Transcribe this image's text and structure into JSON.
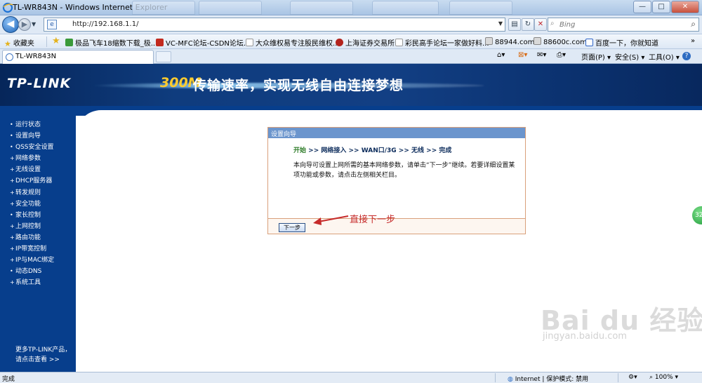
{
  "window": {
    "title": "TL-WR843N - Windows Internet Explorer",
    "min": "—",
    "max": "□",
    "close": "✕"
  },
  "address": {
    "url": "http://192.168.1.1/",
    "search_placeholder": "Bing"
  },
  "favorites": {
    "label": "收藏夹",
    "items": [
      "极品飞车18缩数下载_极...",
      "VC-MFC论坛-CSDN论坛...",
      "大众维权易专注股民维权...",
      "上海证券交易所",
      "彩民高手论坛一家做好料...",
      "88944.com-",
      "88600c.com-",
      "百度一下，你就知道"
    ]
  },
  "tabs": {
    "active": "TL-WR843N"
  },
  "commands": {
    "page": "页面(P)",
    "safety": "安全(S)",
    "tools": "工具(O)",
    "help": "?"
  },
  "banner": {
    "logo": "TP-LINK",
    "slogan_num": "300M",
    "slogan": "传输速率，实现无线自由连接梦想"
  },
  "sidebar": {
    "items": [
      "运行状态",
      "设置向导",
      "QSS安全设置",
      "网络参数",
      "无线设置",
      "DHCP服务器",
      "转发规则",
      "安全功能",
      "家长控制",
      "上网控制",
      "路由功能",
      "IP带宽控制",
      "IP与MAC绑定",
      "动态DNS",
      "系统工具"
    ],
    "more_line1": "更多TP-LINK产品，",
    "more_line2": "请点击查看 >>"
  },
  "wizard": {
    "title": "设置向导",
    "step_first": "开始",
    "step_rest": " >> 网络接入 >> WAN口/3G >> 无线 >> 完成",
    "description": "本向导可设置上网所需的基本网络参数，请单击“下一步”继续。若要详细设置某项功能或参数，请点击左侧相关栏目。",
    "next_button": "下一步"
  },
  "annotation": {
    "text": "直接下一步"
  },
  "side_badge": "32",
  "watermark": {
    "logo": "Bai du 经验",
    "url": "jingyan.baidu.com"
  },
  "status": {
    "left": "完成",
    "zone": "Internet | 保护模式: 禁用",
    "zoom": "100%"
  },
  "colors": {
    "nav_blue": "#073e8c",
    "wizard_header": "#6b95cd",
    "annotation_red": "#c62b2b",
    "first_step_green": "#2f7d2a"
  }
}
